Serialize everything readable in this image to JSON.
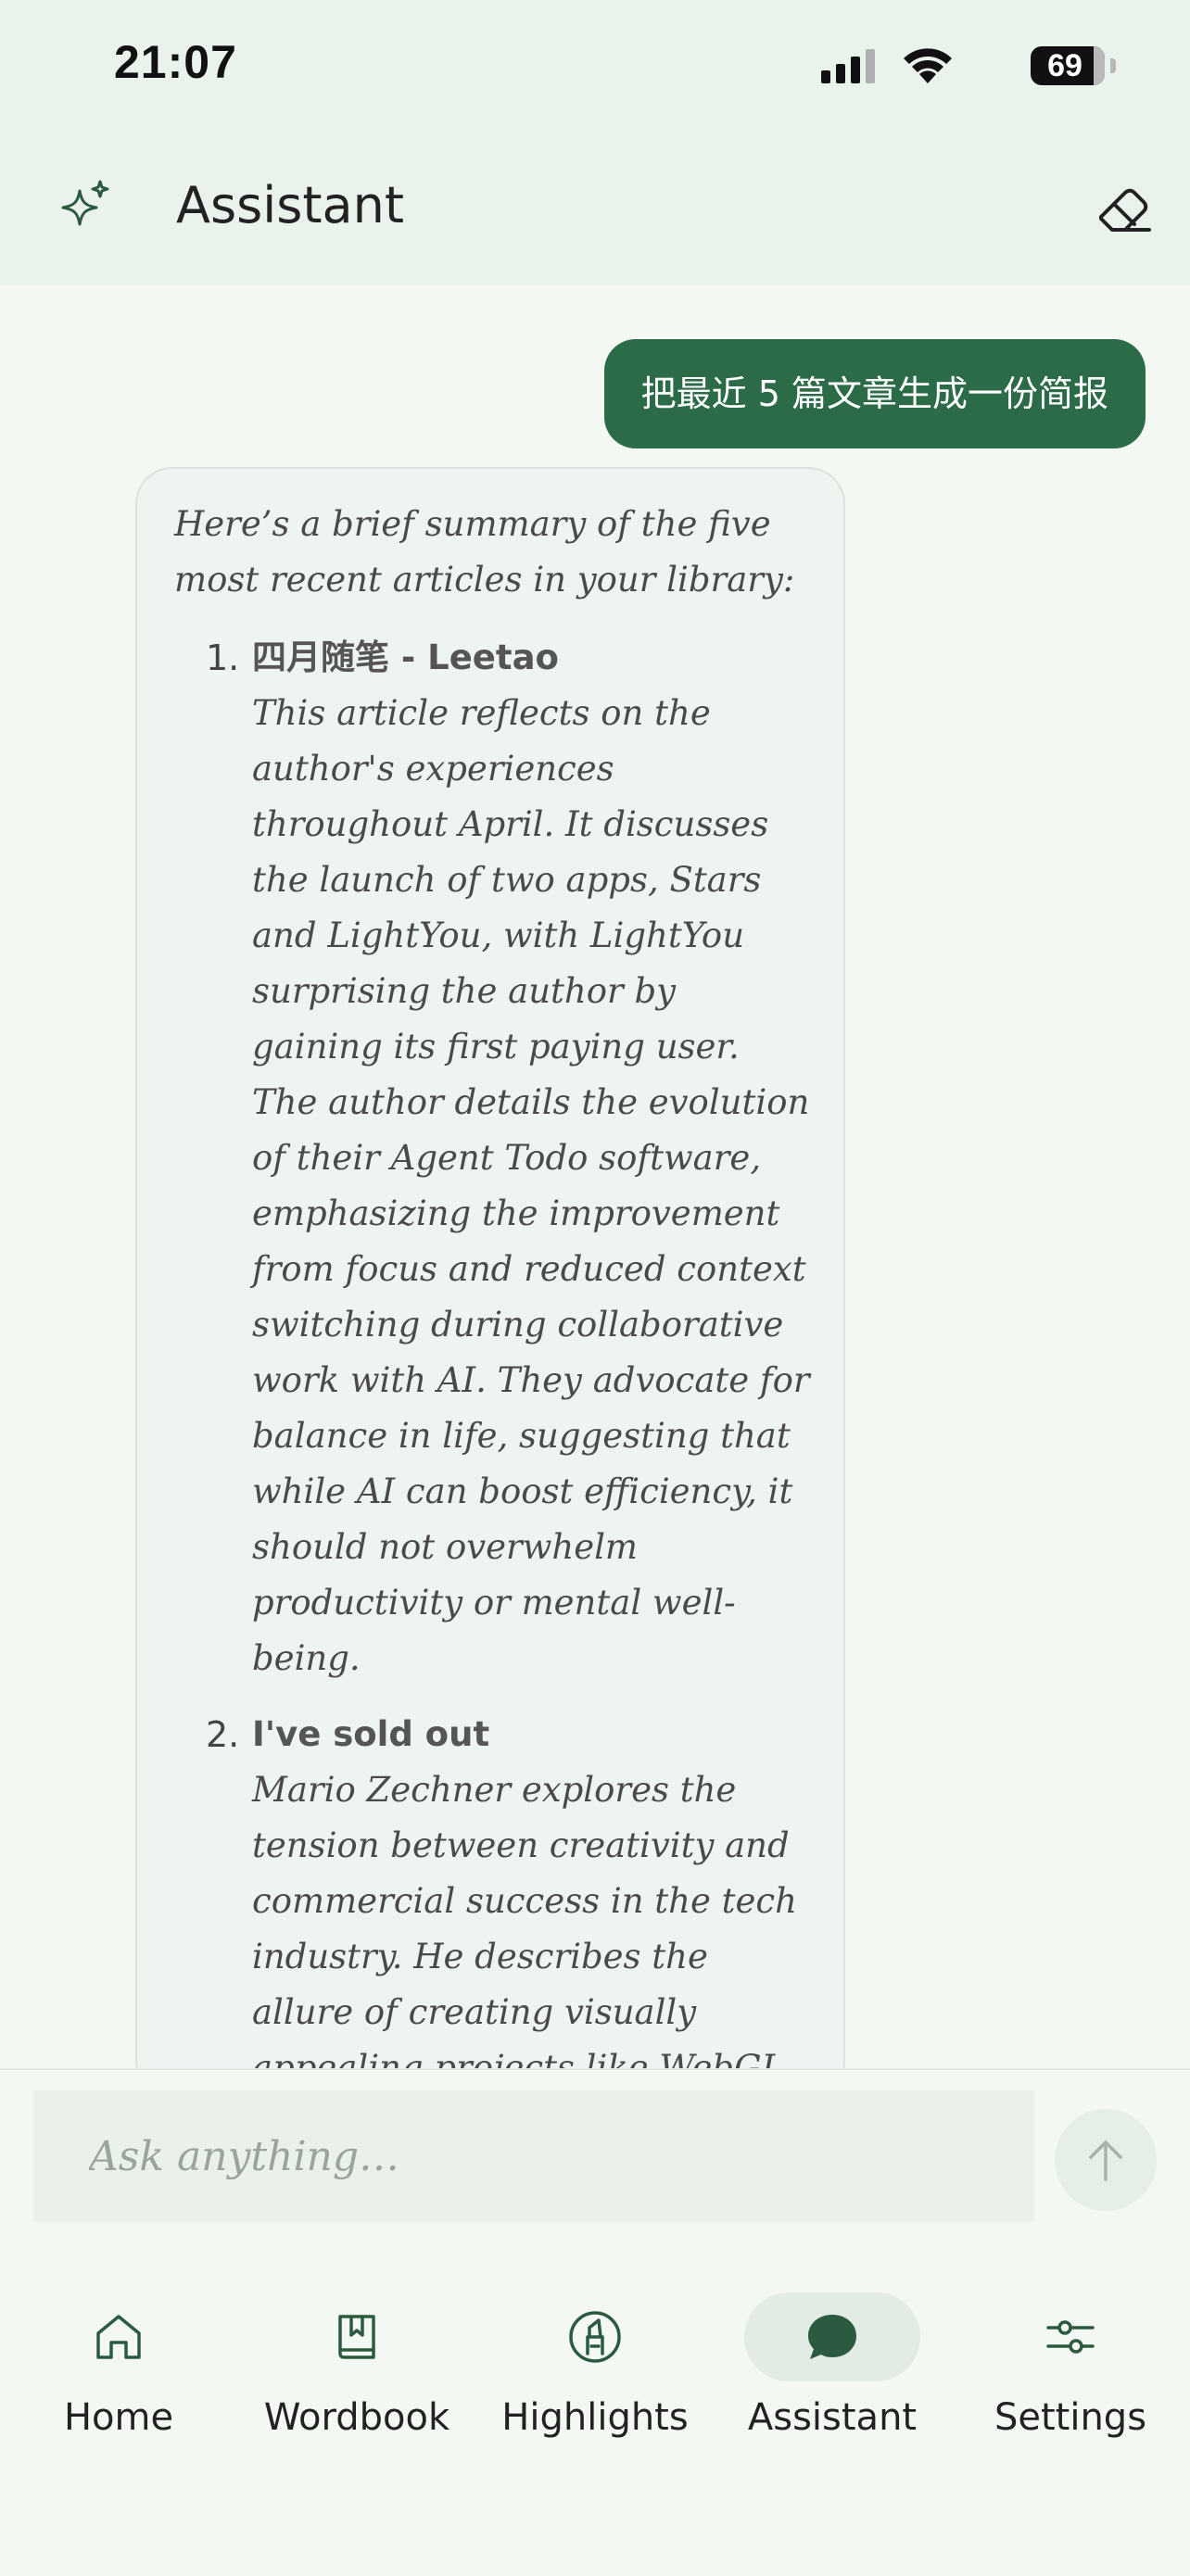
{
  "status_bar": {
    "time": "21:07",
    "battery": "69",
    "icons": [
      "signal-icon",
      "wifi-icon",
      "battery-icon"
    ]
  },
  "header": {
    "title": "Assistant",
    "left_icon": "sparkle-icon",
    "right_icon": "eraser-icon"
  },
  "chat": {
    "user_message": "把最近 5 篇文章生成一份简报",
    "assistant": {
      "intro": "Here’s a brief summary of the five most recent articles in your library:",
      "articles": [
        {
          "number": "1.",
          "title": "四月随笔 - Leetao",
          "summary": "This article reflects on the author's experiences throughout April. It discusses the launch of two apps, Stars and LightYou, with LightYou surprising the author by gaining its first paying user. The author details the evolution of their Agent Todo software, emphasizing the improvement from focus and reduced context switching during collaborative work with AI. They advocate for balance in life, suggesting that while AI can boost efficiency, it should not overwhelm productivity or mental well-being."
        },
        {
          "number": "2.",
          "title": "I've sold out",
          "summary": "Mario Zechner explores the tension between creativity and commercial success in the tech industry. He describes the allure of creating visually appealing projects like WebGL"
        }
      ]
    }
  },
  "input": {
    "placeholder": "Ask anything…",
    "send_icon": "arrow-up-icon"
  },
  "tabs": [
    {
      "label": "Home",
      "icon": "home-icon",
      "active": false
    },
    {
      "label": "Wordbook",
      "icon": "bookmark-book-icon",
      "active": false
    },
    {
      "label": "Highlights",
      "icon": "highlighter-icon",
      "active": false
    },
    {
      "label": "Assistant",
      "icon": "chat-bubble-icon",
      "active": true
    },
    {
      "label": "Settings",
      "icon": "sliders-icon",
      "active": false
    }
  ],
  "colors": {
    "accent": "#2c6b48",
    "background": "#f3f8f3",
    "header_bg": "#eaf2ec",
    "bubble_bg": "#eef4ef"
  }
}
